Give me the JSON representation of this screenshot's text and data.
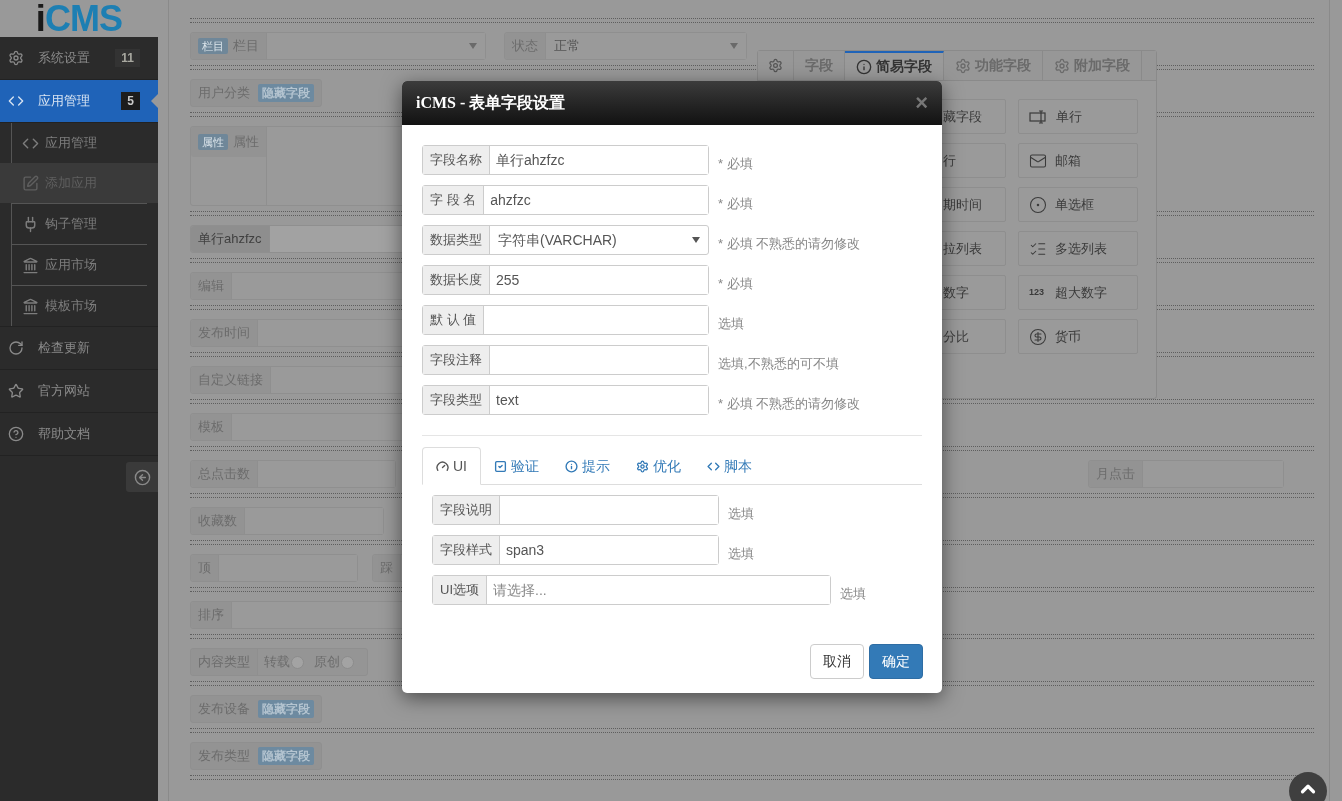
{
  "logo": {
    "letter": "i",
    "rest": "CMS"
  },
  "sidebar": {
    "items": [
      {
        "label": "系统设置",
        "badge": "11",
        "selected": false
      },
      {
        "label": "应用管理",
        "badge": "5",
        "selected": true,
        "expanded": true,
        "children": [
          {
            "label": "应用管理",
            "selected": false
          },
          {
            "label": "添加应用",
            "selected": true
          },
          {
            "label": "钩子管理",
            "selected": false
          },
          {
            "label": "应用市场",
            "selected": false
          },
          {
            "label": "模板市场",
            "selected": false
          }
        ]
      },
      {
        "label": "检查更新",
        "selected": false
      },
      {
        "label": "官方网站",
        "selected": false
      },
      {
        "label": "帮助文档",
        "selected": false
      }
    ]
  },
  "form": {
    "rows": [
      {
        "groups": [
          {
            "kind": "select",
            "tag": "栏目",
            "label": "栏目"
          },
          {
            "kind": "select",
            "label": "状态",
            "value": "正常"
          }
        ]
      },
      {
        "groups": [
          {
            "kind": "hidden",
            "label": "用户分类",
            "badge": "隐藏字段"
          }
        ]
      },
      {
        "groups": [
          {
            "kind": "textarea",
            "tag": "属性",
            "label": "属性"
          }
        ]
      },
      {
        "groups": [
          {
            "kind": "input",
            "label": "单行ahzfzc",
            "highlighted": true
          }
        ]
      },
      {
        "groups": [
          {
            "kind": "input",
            "label": "编辑",
            "highlighted": false
          }
        ]
      },
      {
        "groups": [
          {
            "kind": "input",
            "label": "发布时间",
            "highlighted": false
          }
        ]
      },
      {
        "groups": [
          {
            "kind": "input",
            "label": "自定义链接",
            "highlighted": false
          }
        ]
      },
      {
        "groups": [
          {
            "kind": "input",
            "label": "模板",
            "highlighted": false
          }
        ]
      },
      {
        "groups": [
          {
            "kind": "input",
            "label": "总点击数",
            "highlighted": false
          },
          {
            "kind": "input",
            "label": "月点击",
            "highlighted": false
          }
        ]
      },
      {
        "groups": [
          {
            "kind": "input",
            "label": "收藏数",
            "highlighted": false
          }
        ]
      },
      {
        "groups": [
          {
            "kind": "input",
            "label": "顶",
            "highlighted": false
          },
          {
            "kind": "input",
            "label": "踩",
            "highlighted": false
          }
        ]
      },
      {
        "groups": [
          {
            "kind": "input",
            "label": "排序",
            "highlighted": false
          }
        ]
      },
      {
        "groups": [
          {
            "kind": "radio",
            "label": "内容类型",
            "options": [
              {
                "label": "转载",
                "checked": false
              },
              {
                "label": "原创",
                "checked": false
              }
            ]
          }
        ]
      },
      {
        "groups": [
          {
            "kind": "hidden",
            "label": "发布设备",
            "badge": "隐藏字段"
          }
        ]
      },
      {
        "groups": [
          {
            "kind": "hidden",
            "label": "发布类型",
            "badge": "隐藏字段"
          }
        ]
      }
    ]
  },
  "field_panel": {
    "tabs": [
      {
        "label": "字段",
        "selected": false
      },
      {
        "label": "简易字段",
        "selected": true
      },
      {
        "label": "功能字段",
        "selected": false
      },
      {
        "label": "附加字段",
        "selected": false
      }
    ],
    "left_items": [
      "藏字段",
      "行",
      "期时间",
      "拉列表",
      "数字",
      "分比"
    ],
    "right_items": [
      {
        "label": "单行"
      },
      {
        "label": "邮箱"
      },
      {
        "label": "单选框"
      },
      {
        "label": "多选列表"
      },
      {
        "label": "超大数字",
        "icon_text": "123"
      },
      {
        "label": "货币"
      }
    ]
  },
  "dialog": {
    "title": "iCMS - 表单字段设置",
    "close": "×",
    "fields": [
      {
        "kind": "input",
        "label": "字段名称",
        "value": "单行ahzfzc",
        "hint": "* 必填"
      },
      {
        "kind": "input",
        "label": "字 段 名",
        "value": "ahzfzc",
        "hint": "* 必填"
      },
      {
        "kind": "select",
        "label": "数据类型",
        "value": "字符串(VARCHAR)",
        "hint": "* 必填 不熟悉的请勿修改"
      },
      {
        "kind": "input",
        "label": "数据长度",
        "value": "255",
        "hint": "* 必填"
      },
      {
        "kind": "input",
        "label": "默 认 值",
        "hint": "选填"
      },
      {
        "kind": "input",
        "label": "字段注释",
        "hint": "选填,不熟悉的可不填"
      },
      {
        "kind": "input",
        "label": "字段类型",
        "value": "text",
        "hint": "* 必填 不熟悉的请勿修改"
      }
    ],
    "tabs": [
      {
        "label": "UI",
        "selected": true
      },
      {
        "label": "验证",
        "selected": false
      },
      {
        "label": "提示",
        "selected": false
      },
      {
        "label": "优化",
        "selected": false
      },
      {
        "label": "脚本",
        "selected": false
      }
    ],
    "tab_fields": [
      {
        "kind": "input",
        "label": "字段说明",
        "hint": "选填"
      },
      {
        "kind": "input",
        "label": "字段样式",
        "value": "span3",
        "hint": "选填"
      },
      {
        "kind": "wide",
        "label": "UI选项",
        "placeholder": "请选择...",
        "hint": "选填"
      }
    ],
    "buttons": [
      {
        "label": "取消",
        "kind": "default"
      },
      {
        "label": "确定",
        "kind": "primary"
      }
    ]
  }
}
